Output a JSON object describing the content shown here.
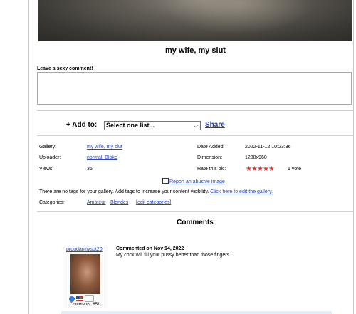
{
  "photo": {
    "title": "my wife, my slut"
  },
  "comment_form": {
    "label": "Leave a sexy comment!",
    "value": ""
  },
  "add_to": {
    "label": "+ Add to:",
    "select_value": "Select one list...",
    "share_label": "Share"
  },
  "details": {
    "gallery_label": "Gallery:",
    "gallery_value": "my wife, my slut",
    "uploader_label": "Uploader:",
    "uploader_value": "normal_Bloke",
    "views_label": "Views:",
    "views_value": "36",
    "date_label": "Date Added:",
    "date_value": "2022-11-12 10:23:36",
    "dimension_label": "Dimension:",
    "dimension_value": "1280x960",
    "rate_label": "Rate this pic:",
    "rating_stars": 5,
    "votes_value": "1 vote"
  },
  "report": {
    "label": "Report an abusive image"
  },
  "tags": {
    "text": "There are no tags for your gallery. Add tags to increase your content visibility.",
    "link": "Click here to edit the gallery."
  },
  "categories": {
    "label": "Categories:",
    "items": [
      "Amateur",
      "Blondes"
    ],
    "edit": "[edit categories]"
  },
  "comments": {
    "title": "Comments",
    "items": [
      {
        "username": "proudarmysgt20",
        "count_text": "Comments: 851",
        "date": "Commented on Nov 14, 2022",
        "text": "My cock will fill your pussy better than those fingers"
      }
    ]
  }
}
